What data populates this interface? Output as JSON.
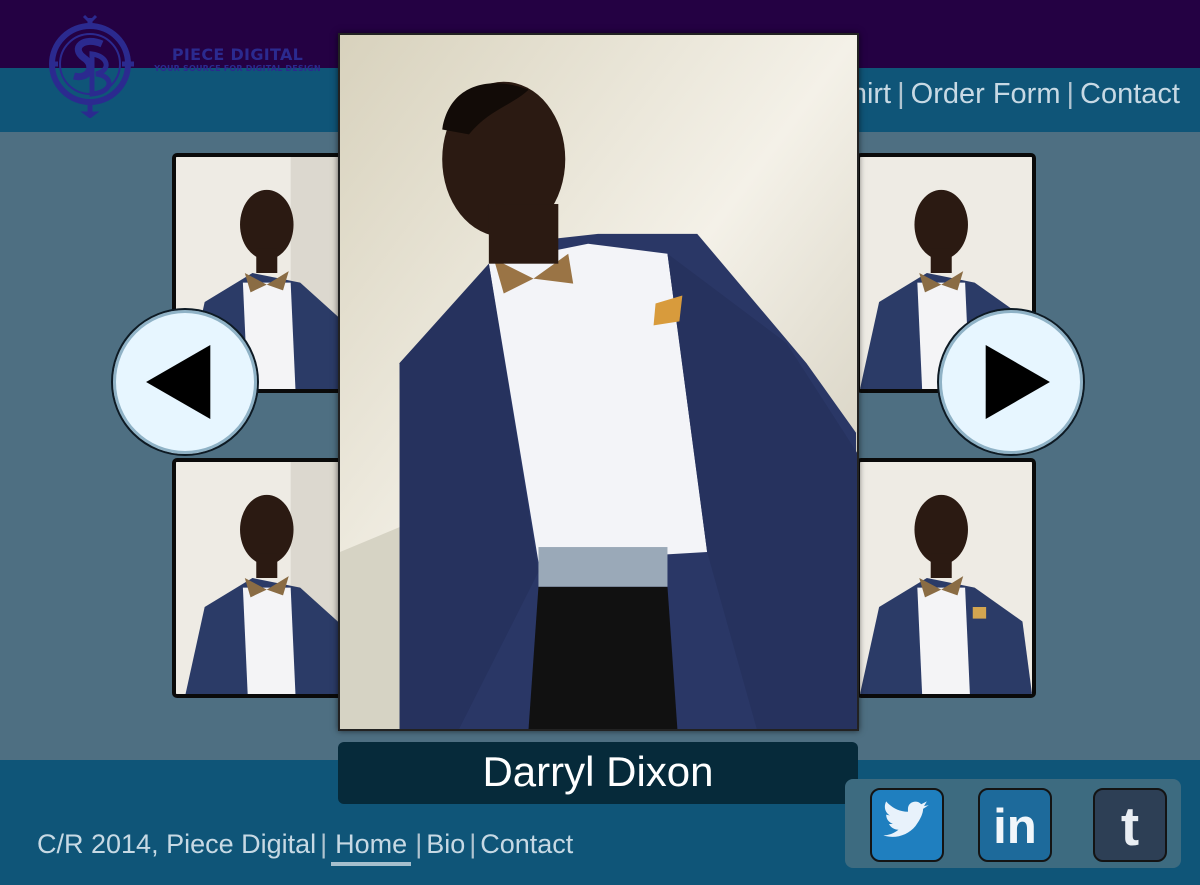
{
  "brand": {
    "name": "PIECE DIGITAL",
    "tagline": "YOUR SOURCE FOR DIGITAL DESIGN",
    "logo_icon": "compass-sd-logo-icon"
  },
  "nav": {
    "items": [
      "hirt",
      "Order Form",
      "Contact"
    ],
    "separator": "|"
  },
  "gallery": {
    "featured_name": "Darryl Dixon",
    "prev_icon": "left-arrow-icon",
    "next_icon": "right-arrow-icon"
  },
  "footer": {
    "copyright": "C/R 2014, Piece Digital",
    "links": [
      "Home",
      "Bio",
      "Contact"
    ],
    "separator": "|"
  },
  "social": {
    "twitter_icon": "twitter-icon",
    "linkedin_label": "in",
    "tumblr_label": "t"
  },
  "colors": {
    "top_bar": "#240143",
    "nav_band": "#0f5578",
    "page_bg": "#4e6f82",
    "name_plate": "#062a3a",
    "arrow_bg": "#e7f6ff"
  }
}
